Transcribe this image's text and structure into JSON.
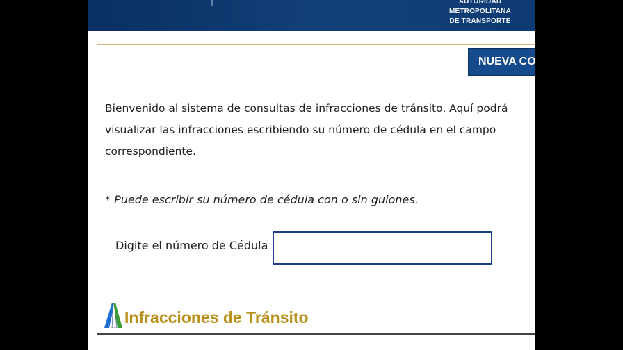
{
  "header": {
    "authority_line1": "AUTORIDAD METROPOLITANA",
    "authority_line2": "DE TRANSPORTE",
    "bar_color": "#0a2f63"
  },
  "toolbar": {
    "new_query_label": "NUEVA CONS"
  },
  "content": {
    "intro_line1": "Bienvenido al sistema de consultas de infracciones de tránsito. Aquí podrá",
    "intro_line2": "visualizar las infracciones escribiendo su número de cédula en el campo",
    "intro_line3": "correspondiente.",
    "note": "* Puede escribir su número de cédula con o sin guiones.",
    "id_label": "Digite el número de Cédula",
    "id_value": "",
    "id_placeholder": ""
  },
  "footer": {
    "brand_title": "Infracciones de Tránsito",
    "brand_color": "#b8901a",
    "logo_colors": [
      "#1f6fd1",
      "#3a9c33"
    ]
  }
}
